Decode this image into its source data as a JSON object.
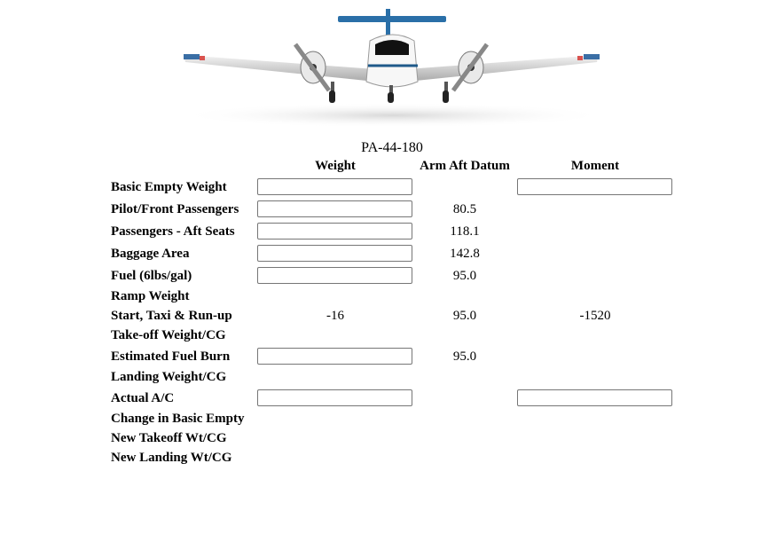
{
  "title": "PA-44-180",
  "headers": {
    "weight": "Weight",
    "arm": "Arm Aft Datum",
    "moment": "Moment"
  },
  "rows": [
    {
      "label": "Basic Empty Weight",
      "weight_input": "",
      "arm": "",
      "moment_input": ""
    },
    {
      "label": "Pilot/Front Passengers",
      "weight_input": "",
      "arm": "80.5"
    },
    {
      "label": "Passengers - Aft Seats",
      "weight_input": "",
      "arm": "118.1"
    },
    {
      "label": "Baggage Area",
      "weight_input": "",
      "arm": "142.8"
    },
    {
      "label": "Fuel (6lbs/gal)",
      "weight_input": "",
      "arm": "95.0"
    },
    {
      "label": "Ramp Weight"
    },
    {
      "label": "Start, Taxi & Run-up",
      "weight": "-16",
      "arm": "95.0",
      "moment": "-1520"
    },
    {
      "label": "Take-off Weight/CG"
    },
    {
      "label": "Estimated Fuel Burn",
      "weight_input": "",
      "arm": "95.0"
    },
    {
      "label": "Landing Weight/CG"
    },
    {
      "label": "Actual A/C",
      "weight_input": "",
      "moment_input": ""
    },
    {
      "label": "Change in Basic Empty"
    },
    {
      "label": "New Takeoff Wt/CG"
    },
    {
      "label": "New Landing Wt/CG"
    }
  ],
  "colors": {
    "plane_body": "#ffffff",
    "plane_stripe": "#1f5a8a",
    "wing_tip": "#d9534f"
  }
}
